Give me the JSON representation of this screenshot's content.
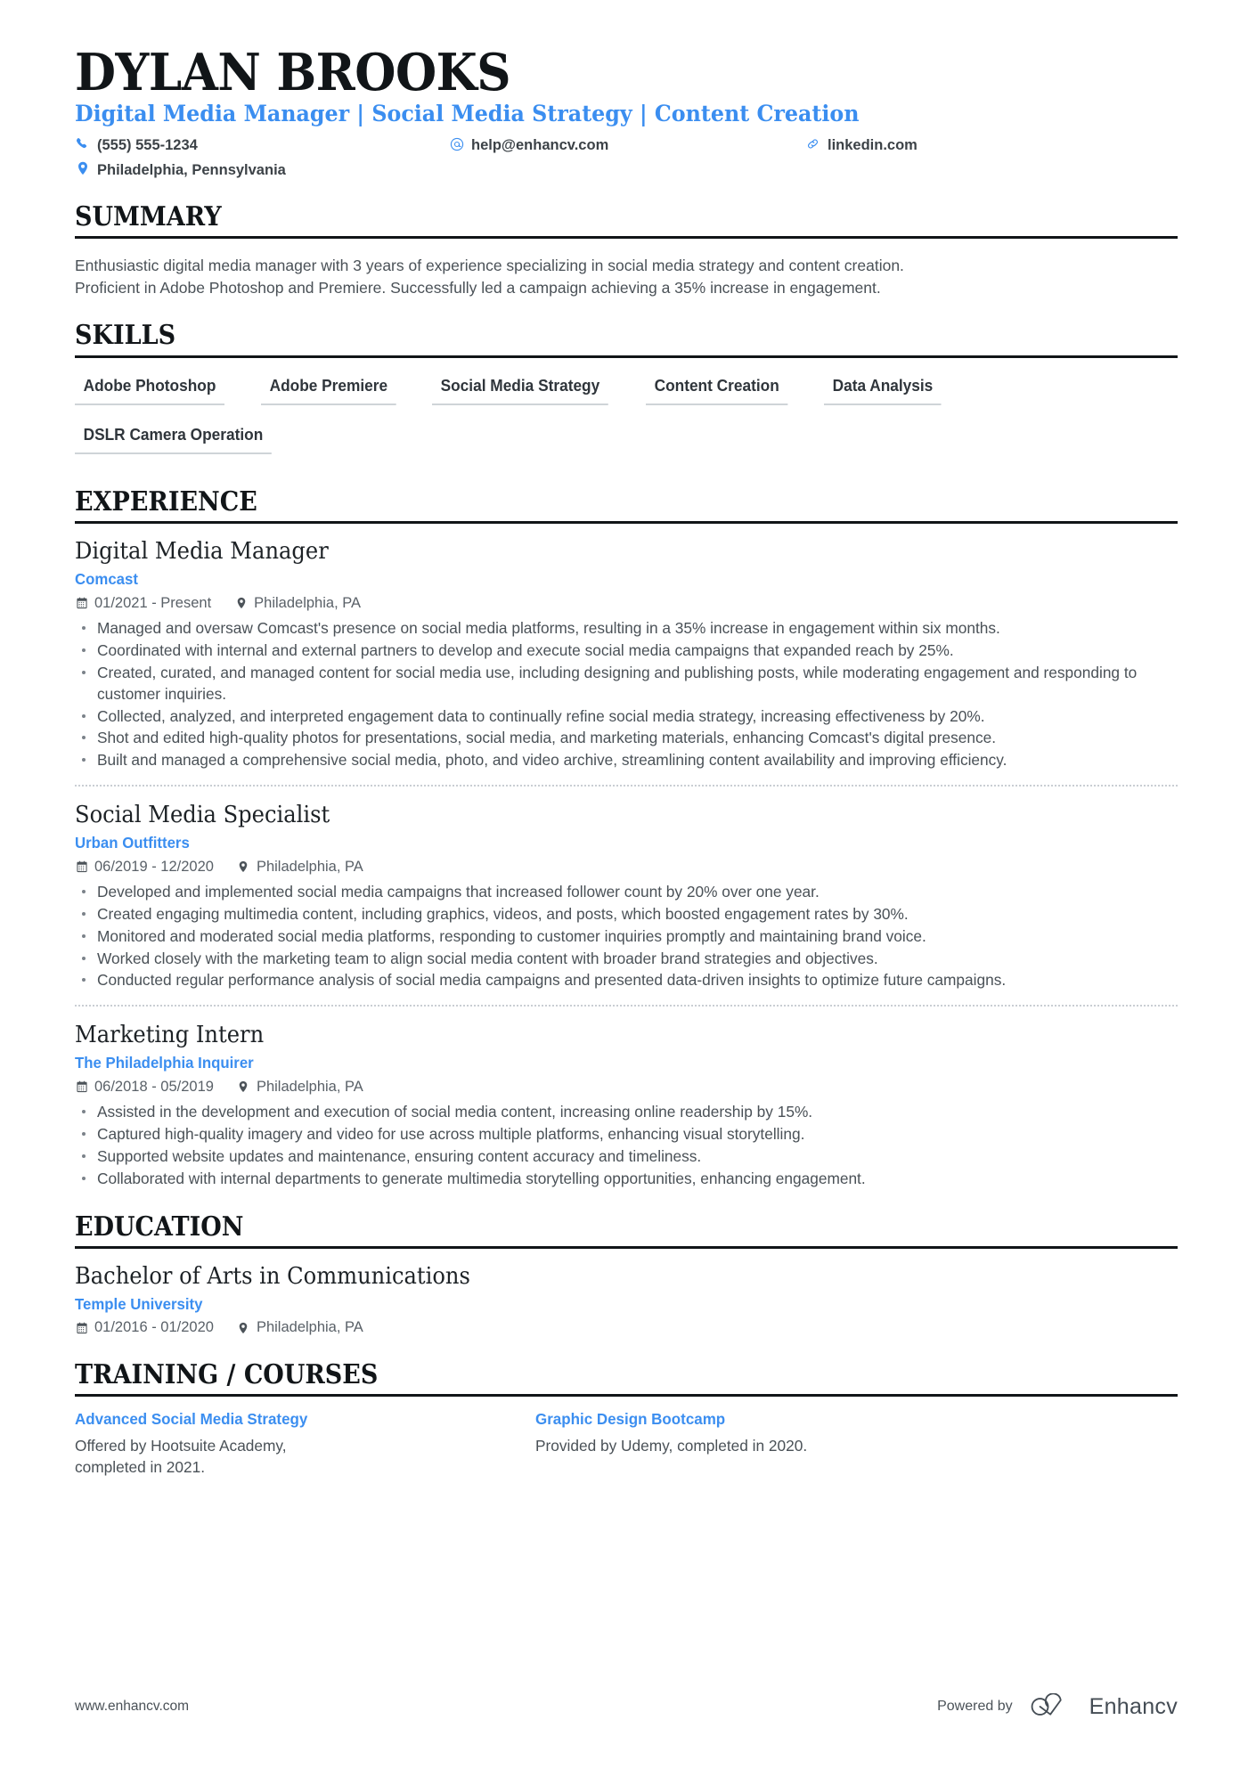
{
  "header": {
    "name": "DYLAN BROOKS",
    "headline": "Digital Media Manager | Social Media Strategy | Content Creation",
    "accent_color": "#3b8ef0",
    "contacts": [
      {
        "icon": "phone-icon",
        "text": "(555) 555-1234"
      },
      {
        "icon": "email-icon",
        "text": "help@enhancv.com"
      },
      {
        "icon": "link-icon",
        "text": "linkedin.com"
      },
      {
        "icon": "location-pin-icon",
        "text": "Philadelphia, Pennsylvania"
      }
    ]
  },
  "summary": {
    "title": "SUMMARY",
    "text": "Enthusiastic digital media manager with 3 years of experience specializing in social media strategy and content creation. Proficient in Adobe Photoshop and Premiere. Successfully led a campaign achieving a 35% increase in engagement."
  },
  "skills": {
    "title": "SKILLS",
    "items": [
      "Adobe Photoshop",
      "Adobe Premiere",
      "Social Media Strategy",
      "Content Creation",
      "Data Analysis",
      "DSLR Camera Operation"
    ]
  },
  "experience": {
    "title": "EXPERIENCE",
    "entries": [
      {
        "role": "Digital Media Manager",
        "company": "Comcast",
        "dates": "01/2021 - Present",
        "location": "Philadelphia, PA",
        "bullets": [
          "Managed and oversaw Comcast's presence on social media platforms, resulting in a 35% increase in engagement within six months.",
          "Coordinated with internal and external partners to develop and execute social media campaigns that expanded reach by 25%.",
          "Created, curated, and managed content for social media use, including designing and publishing posts, while moderating engagement and responding to customer inquiries.",
          "Collected, analyzed, and interpreted engagement data to continually refine social media strategy, increasing effectiveness by 20%.",
          "Shot and edited high-quality photos for presentations, social media, and marketing materials, enhancing Comcast's digital presence.",
          "Built and managed a comprehensive social media, photo, and video archive, streamlining content availability and improving efficiency."
        ]
      },
      {
        "role": "Social Media Specialist",
        "company": "Urban Outfitters",
        "dates": "06/2019 - 12/2020",
        "location": "Philadelphia, PA",
        "bullets": [
          "Developed and implemented social media campaigns that increased follower count by 20% over one year.",
          "Created engaging multimedia content, including graphics, videos, and posts, which boosted engagement rates by 30%.",
          "Monitored and moderated social media platforms, responding to customer inquiries promptly and maintaining brand voice.",
          "Worked closely with the marketing team to align social media content with broader brand strategies and objectives.",
          "Conducted regular performance analysis of social media campaigns and presented data-driven insights to optimize future campaigns."
        ]
      },
      {
        "role": "Marketing Intern",
        "company": "The Philadelphia Inquirer",
        "dates": "06/2018 - 05/2019",
        "location": "Philadelphia, PA",
        "bullets": [
          "Assisted in the development and execution of social media content, increasing online readership by 15%.",
          "Captured high-quality imagery and video for use across multiple platforms, enhancing visual storytelling.",
          "Supported website updates and maintenance, ensuring content accuracy and timeliness.",
          "Collaborated with internal departments to generate multimedia storytelling opportunities, enhancing engagement."
        ]
      }
    ]
  },
  "education": {
    "title": "EDUCATION",
    "entries": [
      {
        "degree": "Bachelor of Arts in Communications",
        "school": "Temple University",
        "dates": "01/2016 - 01/2020",
        "location": "Philadelphia, PA"
      }
    ]
  },
  "training": {
    "title": "TRAINING / COURSES",
    "courses": [
      {
        "name": "Advanced Social Media Strategy",
        "description": "Offered by Hootsuite Academy, completed in 2021."
      },
      {
        "name": "Graphic Design Bootcamp",
        "description": "Provided by Udemy, completed in 2020."
      }
    ]
  },
  "footer": {
    "url": "www.enhancv.com",
    "powered_by": "Powered by",
    "brand": "Enhancv"
  }
}
